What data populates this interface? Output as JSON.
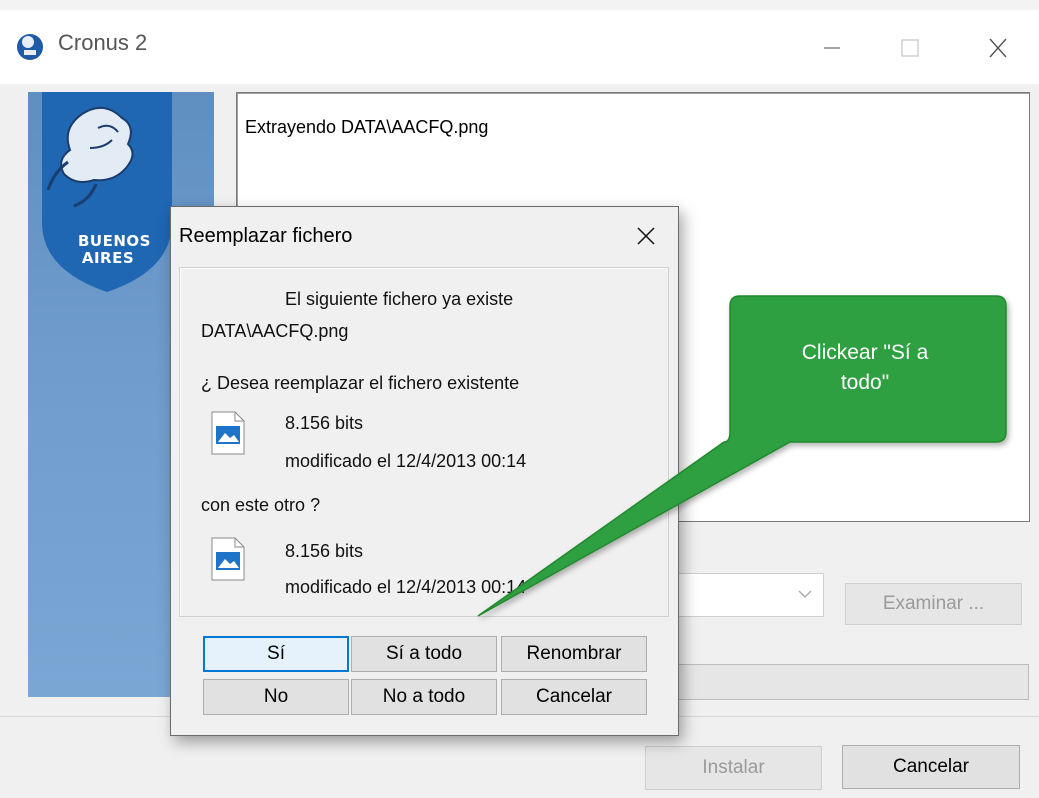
{
  "window": {
    "title": "Cronus 2",
    "icon": "cronus-app-icon",
    "controls": [
      "minimize-icon",
      "maximize-icon",
      "close-icon"
    ]
  },
  "banner": {
    "logo_text_line1": "BUENOS",
    "logo_text_line2": "AIRES",
    "accent": "#5f8fc1"
  },
  "log": {
    "line1": "Extrayendo DATA\\AACFQ.png"
  },
  "dest": {
    "browse_label": "Examinar ..."
  },
  "footer": {
    "install_label": "Instalar",
    "cancel_label": "Cancelar"
  },
  "dialog": {
    "title": "Reemplazar fichero",
    "msg_exists": "El siguiente fichero ya existe",
    "filename": "DATA\\AACFQ.png",
    "question": "¿ Desea reemplazar el fichero existente",
    "existing_size": "8.156 bits",
    "existing_modified": "modificado el 12/4/2013 00:14",
    "with_other": "con este otro ?",
    "new_size": "8.156 bits",
    "new_modified": "modificado el 12/4/2013 00:14",
    "buttons": {
      "yes": "Sí",
      "yes_all": "Sí a todo",
      "rename": "Renombrar",
      "no": "No",
      "no_all": "No a todo",
      "cancel": "Cancelar"
    }
  },
  "annotation": {
    "line1": "Clickear \"Sí a",
    "line2": "todo\"",
    "color": "#2ea043"
  }
}
